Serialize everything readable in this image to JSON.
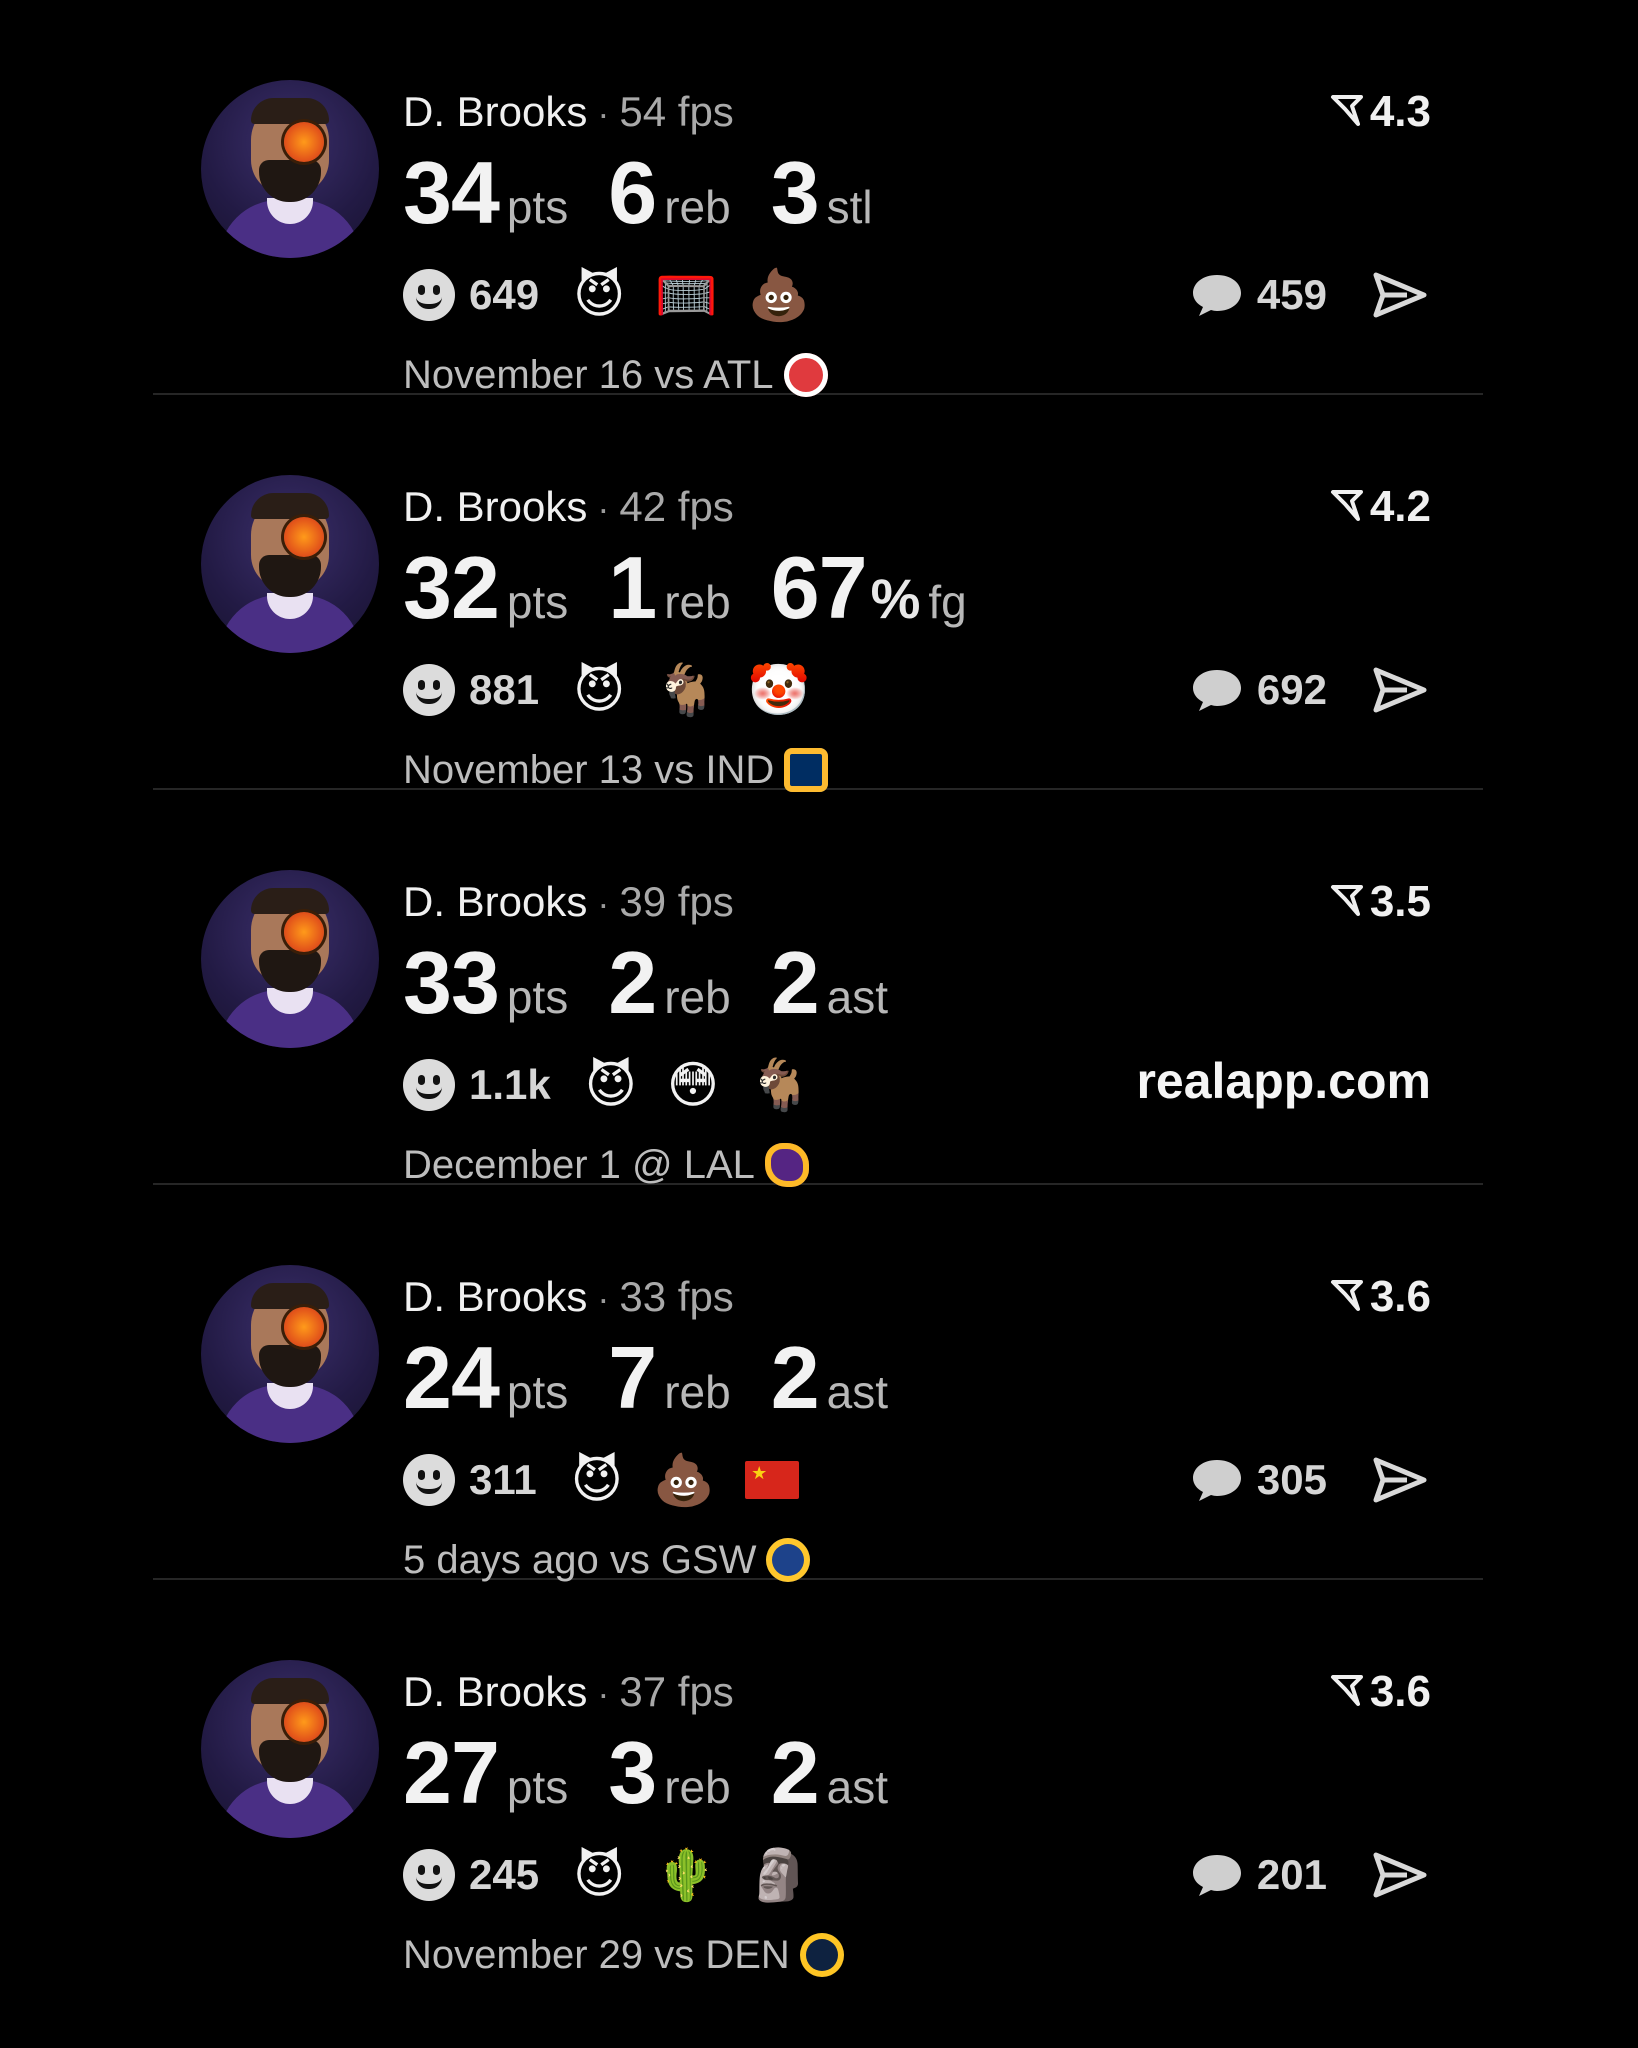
{
  "posts": [
    {
      "player": "D. Brooks",
      "fps_value": "54",
      "fps_unit": "fps",
      "rating": "4.3",
      "stats": [
        {
          "value": "34",
          "unit": "pts"
        },
        {
          "value": "6",
          "unit": "reb"
        },
        {
          "value": "3",
          "unit": "stl"
        }
      ],
      "reactions_count": "649",
      "emojis": [
        "😈",
        "🥅",
        "💩"
      ],
      "comments_count": "459",
      "meta": "November 16 vs ATL",
      "team_logo": "atl",
      "watermark": null
    },
    {
      "player": "D. Brooks",
      "fps_value": "42",
      "fps_unit": "fps",
      "rating": "4.2",
      "stats": [
        {
          "value": "32",
          "unit": "pts"
        },
        {
          "value": "1",
          "unit": "reb"
        },
        {
          "value": "67",
          "unit": "fg",
          "pct": "%"
        }
      ],
      "reactions_count": "881",
      "emojis": [
        "😈",
        "🐐",
        "🤡"
      ],
      "comments_count": "692",
      "meta": "November 13 vs IND",
      "team_logo": "ind",
      "watermark": null
    },
    {
      "player": "D. Brooks",
      "fps_value": "39",
      "fps_unit": "fps",
      "rating": "3.5",
      "stats": [
        {
          "value": "33",
          "unit": "pts"
        },
        {
          "value": "2",
          "unit": "reb"
        },
        {
          "value": "2",
          "unit": "ast"
        }
      ],
      "reactions_count": "1.1k",
      "emojis": [
        "😈",
        "😳",
        "🐐"
      ],
      "comments_count": null,
      "meta": "December 1 @ LAL",
      "team_logo": "lal",
      "watermark": "realapp.com"
    },
    {
      "player": "D. Brooks",
      "fps_value": "33",
      "fps_unit": "fps",
      "rating": "3.6",
      "stats": [
        {
          "value": "24",
          "unit": "pts"
        },
        {
          "value": "7",
          "unit": "reb"
        },
        {
          "value": "2",
          "unit": "ast"
        }
      ],
      "reactions_count": "311",
      "emojis": [
        "😈",
        "💩",
        "flag-cn"
      ],
      "comments_count": "305",
      "meta": "5 days ago vs GSW",
      "team_logo": "gsw",
      "watermark": null
    },
    {
      "player": "D. Brooks",
      "fps_value": "37",
      "fps_unit": "fps",
      "rating": "3.6",
      "stats": [
        {
          "value": "27",
          "unit": "pts"
        },
        {
          "value": "3",
          "unit": "reb"
        },
        {
          "value": "2",
          "unit": "ast"
        }
      ],
      "reactions_count": "245",
      "emojis": [
        "😈",
        "🌵",
        "🗿"
      ],
      "comments_count": "201",
      "meta": "November 29 vs DEN",
      "team_logo": "den",
      "watermark": null
    }
  ],
  "icons": {
    "rating": "rating-arrow-icon",
    "reaction": "smiley-icon",
    "comment": "comment-bubble-icon",
    "share": "send-arrow-icon"
  }
}
